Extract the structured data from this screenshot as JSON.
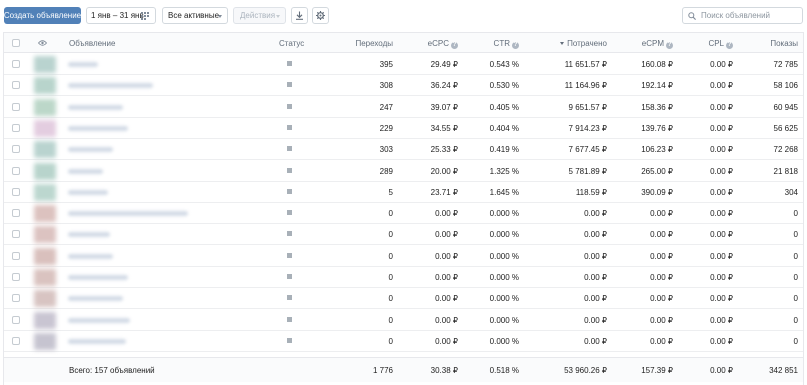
{
  "toolbar": {
    "create_label": "Создать объявление",
    "date_range": "1 янв – 31 янв",
    "filter_label": "Все активные",
    "actions_label": "Действия",
    "search_placeholder": "Поиск объявлений"
  },
  "colors": {
    "primary": "#5181b8",
    "border": "#d3d9de",
    "header_bg": "#fafbfc"
  },
  "icons": {
    "calendar": "calendar-icon",
    "download": "download-icon",
    "settings": "gear-icon",
    "search": "search-icon",
    "eye": "eye-icon",
    "help": "help-circle-icon"
  },
  "columns": {
    "ad": "Объявление",
    "status": "Статус",
    "clicks": "Переходы",
    "ecpc": "eCPC",
    "ctr": "CTR",
    "spent": "Потрачено",
    "ecpm": "eCPM",
    "cpl": "CPL",
    "impressions": "Показы"
  },
  "rows": [
    {
      "clicks": "395",
      "ecpc": "29.49 ₽",
      "ctr": "0.543 %",
      "spent": "11 651.57 ₽",
      "ecpm": "160.08 ₽",
      "cpl": "0.00 ₽",
      "impressions": "72 785"
    },
    {
      "clicks": "308",
      "ecpc": "36.24 ₽",
      "ctr": "0.530 %",
      "spent": "11 164.96 ₽",
      "ecpm": "192.14 ₽",
      "cpl": "0.00 ₽",
      "impressions": "58 106"
    },
    {
      "clicks": "247",
      "ecpc": "39.07 ₽",
      "ctr": "0.405 %",
      "spent": "9 651.57 ₽",
      "ecpm": "158.36 ₽",
      "cpl": "0.00 ₽",
      "impressions": "60 945"
    },
    {
      "clicks": "229",
      "ecpc": "34.55 ₽",
      "ctr": "0.404 %",
      "spent": "7 914.23 ₽",
      "ecpm": "139.76 ₽",
      "cpl": "0.00 ₽",
      "impressions": "56 625"
    },
    {
      "clicks": "303",
      "ecpc": "25.33 ₽",
      "ctr": "0.419 %",
      "spent": "7 677.45 ₽",
      "ecpm": "106.23 ₽",
      "cpl": "0.00 ₽",
      "impressions": "72 268"
    },
    {
      "clicks": "289",
      "ecpc": "20.00 ₽",
      "ctr": "1.325 %",
      "spent": "5 781.89 ₽",
      "ecpm": "265.00 ₽",
      "cpl": "0.00 ₽",
      "impressions": "21 818"
    },
    {
      "clicks": "5",
      "ecpc": "23.71 ₽",
      "ctr": "1.645 %",
      "spent": "118.59 ₽",
      "ecpm": "390.09 ₽",
      "cpl": "0.00 ₽",
      "impressions": "304"
    },
    {
      "clicks": "0",
      "ecpc": "0.00 ₽",
      "ctr": "0.000 %",
      "spent": "0.00 ₽",
      "ecpm": "0.00 ₽",
      "cpl": "0.00 ₽",
      "impressions": "0"
    },
    {
      "clicks": "0",
      "ecpc": "0.00 ₽",
      "ctr": "0.000 %",
      "spent": "0.00 ₽",
      "ecpm": "0.00 ₽",
      "cpl": "0.00 ₽",
      "impressions": "0"
    },
    {
      "clicks": "0",
      "ecpc": "0.00 ₽",
      "ctr": "0.000 %",
      "spent": "0.00 ₽",
      "ecpm": "0.00 ₽",
      "cpl": "0.00 ₽",
      "impressions": "0"
    },
    {
      "clicks": "0",
      "ecpc": "0.00 ₽",
      "ctr": "0.000 %",
      "spent": "0.00 ₽",
      "ecpm": "0.00 ₽",
      "cpl": "0.00 ₽",
      "impressions": "0"
    },
    {
      "clicks": "0",
      "ecpc": "0.00 ₽",
      "ctr": "0.000 %",
      "spent": "0.00 ₽",
      "ecpm": "0.00 ₽",
      "cpl": "0.00 ₽",
      "impressions": "0"
    },
    {
      "clicks": "0",
      "ecpc": "0.00 ₽",
      "ctr": "0.000 %",
      "spent": "0.00 ₽",
      "ecpm": "0.00 ₽",
      "cpl": "0.00 ₽",
      "impressions": "0"
    },
    {
      "clicks": "0",
      "ecpc": "0.00 ₽",
      "ctr": "0.000 %",
      "spent": "0.00 ₽",
      "ecpm": "0.00 ₽",
      "cpl": "0.00 ₽",
      "impressions": "0"
    }
  ],
  "footer": {
    "total_label": "Всего: 157 объявлений",
    "clicks": "1 776",
    "ecpc": "30.38 ₽",
    "ctr": "0.518 %",
    "spent": "53 960.26 ₽",
    "ecpm": "157.39 ₽",
    "cpl": "0.00 ₽",
    "impressions": "342 851"
  }
}
